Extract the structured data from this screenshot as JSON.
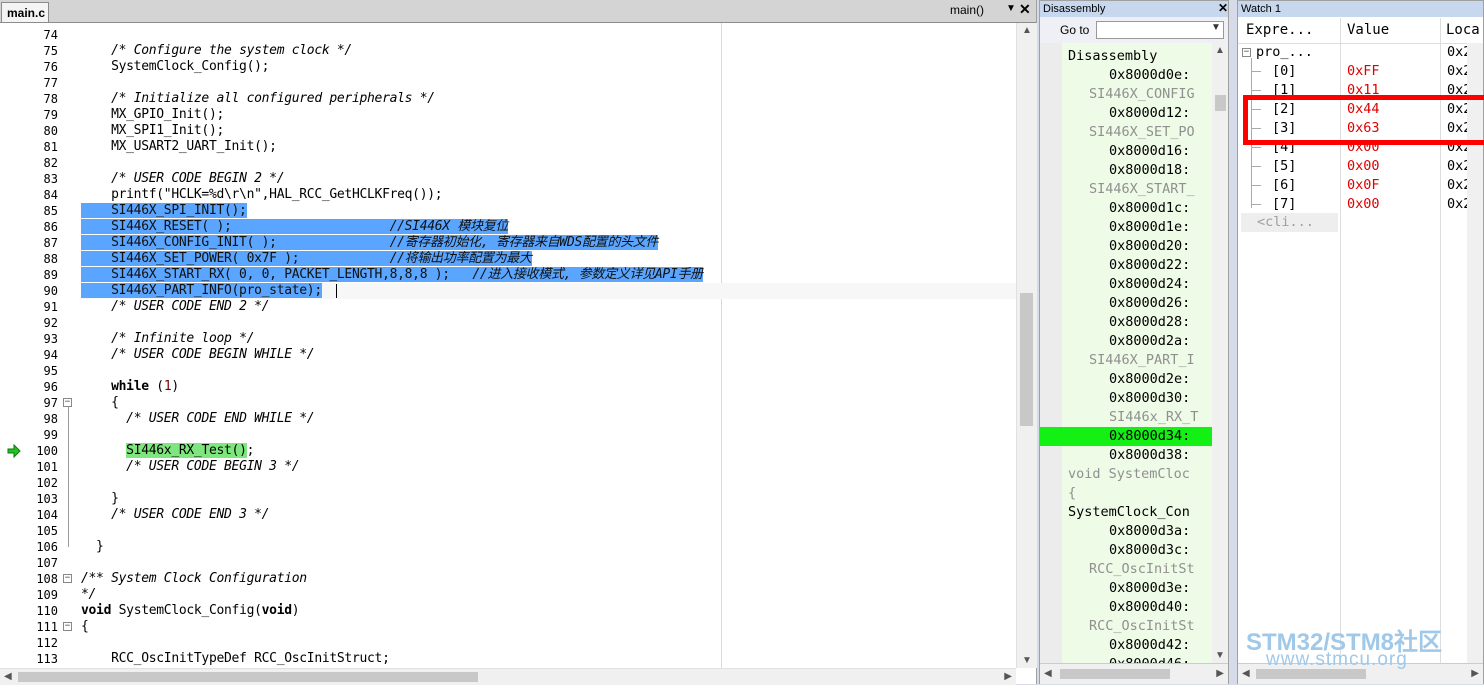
{
  "editor": {
    "tab": "main.c",
    "func_selector": "main()",
    "close_glyph": "✕",
    "lines": [
      {
        "n": "74",
        "t": []
      },
      {
        "n": "75",
        "t": [
          [
            "    ",
            ""
          ],
          [
            "/* Configure the system clock */",
            "comment"
          ]
        ]
      },
      {
        "n": "76",
        "t": [
          [
            "    SystemClock_Config();",
            ""
          ]
        ]
      },
      {
        "n": "77",
        "t": []
      },
      {
        "n": "78",
        "t": [
          [
            "    ",
            ""
          ],
          [
            "/* Initialize all configured peripherals */",
            "comment"
          ]
        ]
      },
      {
        "n": "79",
        "t": [
          [
            "    MX_GPIO_Init();",
            ""
          ]
        ]
      },
      {
        "n": "80",
        "t": [
          [
            "    MX_SPI1_Init();",
            ""
          ]
        ]
      },
      {
        "n": "81",
        "t": [
          [
            "    MX_USART2_UART_Init();",
            ""
          ]
        ]
      },
      {
        "n": "82",
        "t": []
      },
      {
        "n": "83",
        "t": [
          [
            "    ",
            ""
          ],
          [
            "/* USER CODE BEGIN 2 */",
            "comment"
          ]
        ]
      },
      {
        "n": "84",
        "t": [
          [
            "    printf(\"HCLK=%d\\r\\n\",HAL_RCC_GetHCLKFreq());",
            ""
          ]
        ]
      },
      {
        "n": "85",
        "t": [
          [
            "    SI446X_SPI_INIT();",
            "hl"
          ]
        ]
      },
      {
        "n": "86",
        "t": [
          [
            "    SI446X_RESET( );                     ",
            "hl"
          ],
          [
            "//SI446X 模块复位",
            "hl comment"
          ]
        ]
      },
      {
        "n": "87",
        "t": [
          [
            "    SI446X_CONFIG_INIT( );               ",
            "hl"
          ],
          [
            "//寄存器初始化, 寄存器来自WDS配置的头文件",
            "hl comment"
          ]
        ]
      },
      {
        "n": "88",
        "t": [
          [
            "    SI446X_SET_POWER( 0x7F );            ",
            "hl"
          ],
          [
            "//将输出功率配置为最大",
            "hl comment"
          ]
        ]
      },
      {
        "n": "89",
        "t": [
          [
            "    SI446X_START_RX( 0, 0, PACKET_LENGTH,8,8,8 );   ",
            "hl"
          ],
          [
            "//进入接收模式, 参数定义详见API手册",
            "hl comment"
          ]
        ]
      },
      {
        "n": "90",
        "t": [
          [
            "    SI446X_PART_INFO(pro_state);",
            "hl"
          ]
        ]
      },
      {
        "n": "91",
        "t": [
          [
            "    ",
            ""
          ],
          [
            "/* USER CODE END 2 */",
            "comment"
          ]
        ]
      },
      {
        "n": "92",
        "t": []
      },
      {
        "n": "93",
        "t": [
          [
            "    ",
            ""
          ],
          [
            "/* Infinite loop */",
            "comment"
          ]
        ]
      },
      {
        "n": "94",
        "t": [
          [
            "    ",
            ""
          ],
          [
            "/* USER CODE BEGIN WHILE */",
            "comment"
          ]
        ]
      },
      {
        "n": "95",
        "t": []
      },
      {
        "n": "96",
        "t": [
          [
            "    ",
            ""
          ],
          [
            "while",
            "keyword"
          ],
          [
            " (",
            ""
          ],
          [
            "1",
            "number"
          ],
          [
            ")",
            ""
          ]
        ]
      },
      {
        "n": "97",
        "fold": "−",
        "t": [
          [
            "    {",
            ""
          ]
        ]
      },
      {
        "n": "98",
        "t": [
          [
            "      ",
            ""
          ],
          [
            "/* USER CODE END WHILE */",
            "comment"
          ]
        ]
      },
      {
        "n": "99",
        "t": []
      },
      {
        "n": "100",
        "t": [
          [
            "      ",
            ""
          ],
          [
            "SI446x_RX_Test()",
            "exec"
          ],
          [
            ";",
            ""
          ]
        ]
      },
      {
        "n": "101",
        "t": [
          [
            "      ",
            ""
          ],
          [
            "/* USER CODE BEGIN 3 */",
            "comment"
          ]
        ]
      },
      {
        "n": "102",
        "t": []
      },
      {
        "n": "103",
        "t": [
          [
            "    }",
            ""
          ]
        ]
      },
      {
        "n": "104",
        "t": [
          [
            "    ",
            ""
          ],
          [
            "/* USER CODE END 3 */",
            "comment"
          ]
        ]
      },
      {
        "n": "105",
        "t": []
      },
      {
        "n": "106",
        "t": [
          [
            "  }",
            ""
          ]
        ]
      },
      {
        "n": "107",
        "t": []
      },
      {
        "n": "108",
        "fold": "−",
        "t": [
          [
            "/** System Clock Configuration",
            "comment"
          ]
        ]
      },
      {
        "n": "109",
        "t": [
          [
            "*/",
            "comment"
          ]
        ]
      },
      {
        "n": "110",
        "t": [
          [
            "void",
            "keyword"
          ],
          [
            " SystemClock_Config(",
            ""
          ],
          [
            "void",
            "keyword"
          ],
          [
            ")",
            ""
          ]
        ]
      },
      {
        "n": "111",
        "fold": "−",
        "t": [
          [
            "{",
            ""
          ]
        ]
      },
      {
        "n": "112",
        "t": []
      },
      {
        "n": "113",
        "t": [
          [
            "    RCC_OscInitTypeDef RCC_OscInitStruct;",
            ""
          ]
        ]
      }
    ]
  },
  "disassembly": {
    "title": "Disassembly",
    "goto_label": "Go to",
    "goto_value": "",
    "rows": [
      {
        "t": "Disassembly",
        "k": "hdr"
      },
      {
        "t": "0x8000d0e:",
        "k": "addr"
      },
      {
        "t": "SI446X_CONFIG",
        "k": "sym"
      },
      {
        "t": "0x8000d12:",
        "k": "addr"
      },
      {
        "t": "SI446X_SET_PO",
        "k": "sym"
      },
      {
        "t": "0x8000d16:",
        "k": "addr"
      },
      {
        "t": "0x8000d18:",
        "k": "addr"
      },
      {
        "t": "SI446X_START_",
        "k": "sym"
      },
      {
        "t": "0x8000d1c:",
        "k": "addr"
      },
      {
        "t": "0x8000d1e:",
        "k": "addr"
      },
      {
        "t": "0x8000d20:",
        "k": "addr"
      },
      {
        "t": "0x8000d22:",
        "k": "addr"
      },
      {
        "t": "0x8000d24:",
        "k": "addr"
      },
      {
        "t": "0x8000d26:",
        "k": "addr"
      },
      {
        "t": "0x8000d28:",
        "k": "addr"
      },
      {
        "t": "0x8000d2a:",
        "k": "addr"
      },
      {
        "t": "SI446X_PART_I",
        "k": "sym"
      },
      {
        "t": "0x8000d2e:",
        "k": "addr"
      },
      {
        "t": "0x8000d30:",
        "k": "addr"
      },
      {
        "t": "SI446x_RX_T",
        "k": "sym2"
      },
      {
        "t": "0x8000d34:",
        "k": "cur"
      },
      {
        "t": "0x8000d38:",
        "k": "addr"
      },
      {
        "t": "void SystemCloc",
        "k": "srcg"
      },
      {
        "t": "{",
        "k": "srcg"
      },
      {
        "t": "SystemClock_Con",
        "k": "src"
      },
      {
        "t": "0x8000d3a:",
        "k": "addr"
      },
      {
        "t": "0x8000d3c:",
        "k": "addr"
      },
      {
        "t": "RCC_OscInitSt",
        "k": "sym"
      },
      {
        "t": "0x8000d3e:",
        "k": "addr"
      },
      {
        "t": "0x8000d40:",
        "k": "addr"
      },
      {
        "t": "RCC_OscInitSt",
        "k": "sym"
      },
      {
        "t": "0x8000d42:",
        "k": "addr"
      },
      {
        "t": "0x8000d46:",
        "k": "addr"
      }
    ]
  },
  "watch": {
    "title": "Watch 1",
    "col_expression": "Expre...",
    "col_value": "Value",
    "col_location": "Loca",
    "root_expr": "pro_...",
    "root_loc": "0x2",
    "items": [
      {
        "ex": "[0]",
        "val": "0xFF",
        "loc": "0x2"
      },
      {
        "ex": "[1]",
        "val": "0x11",
        "loc": "0x2"
      },
      {
        "ex": "[2]",
        "val": "0x44",
        "loc": "0x2"
      },
      {
        "ex": "[3]",
        "val": "0x63",
        "loc": "0x2"
      },
      {
        "ex": "[4]",
        "val": "0x00",
        "loc": "0x2"
      },
      {
        "ex": "[5]",
        "val": "0x00",
        "loc": "0x2"
      },
      {
        "ex": "[6]",
        "val": "0x0F",
        "loc": "0x2"
      },
      {
        "ex": "[7]",
        "val": "0x00",
        "loc": "0x2"
      }
    ],
    "click_to_add": "<cli..."
  },
  "watermark": {
    "brand": "STM32/STM8社区",
    "url": "www.stmcu.org"
  },
  "colors": {
    "selection": "#59a5ff",
    "exec_line": "#7de77d",
    "disasm_current": "#13f013",
    "watch_value": "#e00000",
    "annotation_box": "#ff0000"
  }
}
